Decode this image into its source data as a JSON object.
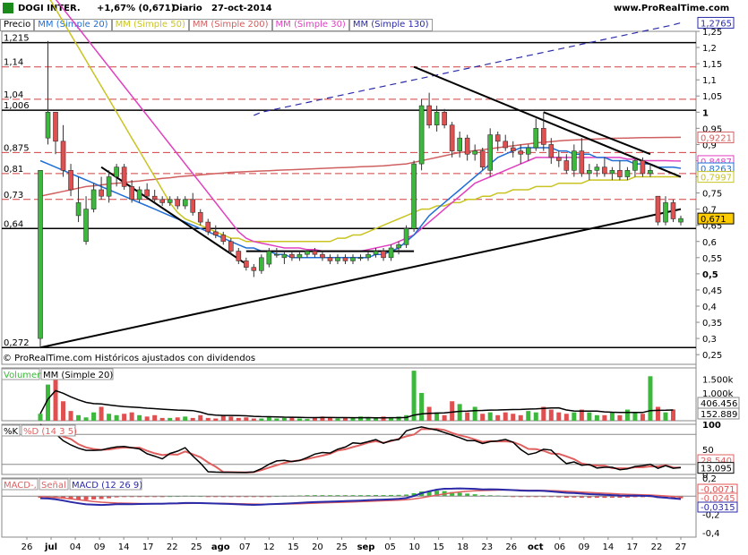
{
  "header": {
    "symbol": "DOGI INTER.",
    "change": "+1,67% (0,671)",
    "period": "Diario",
    "date": "27-oct-2014",
    "site": "www.ProRealTime.com"
  },
  "main_legend": [
    {
      "label": "Precio",
      "color": "#000000"
    },
    {
      "label": "MM (Simple 20)",
      "color": "#1f6fd6"
    },
    {
      "label": "MM (Simple 50)",
      "color": "#c9c422"
    },
    {
      "label": "MM (Simple 200)",
      "color": "#d06060"
    },
    {
      "label": "MM (Simple 30)",
      "color": "#e040c0"
    },
    {
      "label": "MM (Simple 130)",
      "color": "#2a2aa8"
    }
  ],
  "copyright": "© ProRealTime.com Históricos ajustados con dividendos",
  "chart_data": [
    {
      "type": "candlestick",
      "name": "price",
      "price_ticks": [
        "1,25",
        "1,2",
        "1,15",
        "1,1",
        "1,05",
        "1",
        "0,95",
        "0,9",
        "0,85",
        "0,8",
        "0,75",
        "0,7",
        "0,65",
        "0,6",
        "0,55",
        "0,5",
        "0,45",
        "0,4",
        "0,35",
        "0,3",
        "0,25"
      ],
      "ylim": [
        0.22,
        1.25
      ],
      "left_levels": [
        {
          "label": "1,215",
          "value": 1.215
        },
        {
          "label": "1,14",
          "value": 1.14
        },
        {
          "label": "1,04",
          "value": 1.04
        },
        {
          "label": "1,006",
          "value": 1.006
        },
        {
          "label": "0,875",
          "value": 0.875
        },
        {
          "label": "0,81",
          "value": 0.81
        },
        {
          "label": "0,73",
          "value": 0.73
        },
        {
          "label": "0,64",
          "value": 0.64
        },
        {
          "label": "0,272",
          "value": 0.272
        }
      ],
      "value_tags": [
        {
          "label": "1,2765",
          "value": 1.2765,
          "color": "#2a2aa8"
        },
        {
          "label": "0,9221",
          "value": 0.9221,
          "color": "#d06060"
        },
        {
          "label": "0,8487",
          "value": 0.8487,
          "color": "#e040c0"
        },
        {
          "label": "0,8263",
          "value": 0.8263,
          "color": "#1f6fd6"
        },
        {
          "label": "0,7997",
          "value": 0.7997,
          "color": "#c9c422"
        },
        {
          "label": "0,671",
          "value": 0.671,
          "color": "#000000"
        }
      ],
      "candles": [
        [
          0.3,
          0.82,
          0.27,
          0.82
        ],
        [
          0.92,
          1.22,
          0.9,
          1.0
        ],
        [
          1.0,
          1.0,
          0.87,
          0.91
        ],
        [
          0.91,
          0.96,
          0.8,
          0.82
        ],
        [
          0.82,
          0.84,
          0.74,
          0.76
        ],
        [
          0.68,
          0.8,
          0.66,
          0.72
        ],
        [
          0.6,
          0.74,
          0.59,
          0.7
        ],
        [
          0.7,
          0.78,
          0.69,
          0.76
        ],
        [
          0.76,
          0.8,
          0.73,
          0.74
        ],
        [
          0.74,
          0.82,
          0.72,
          0.8
        ],
        [
          0.8,
          0.84,
          0.77,
          0.83
        ],
        [
          0.83,
          0.84,
          0.76,
          0.77
        ],
        [
          0.77,
          0.79,
          0.72,
          0.73
        ],
        [
          0.73,
          0.77,
          0.72,
          0.76
        ],
        [
          0.76,
          0.78,
          0.73,
          0.74
        ],
        [
          0.74,
          0.76,
          0.72,
          0.73
        ],
        [
          0.73,
          0.74,
          0.71,
          0.72
        ],
        [
          0.72,
          0.74,
          0.71,
          0.73
        ],
        [
          0.73,
          0.74,
          0.7,
          0.71
        ],
        [
          0.71,
          0.74,
          0.7,
          0.73
        ],
        [
          0.73,
          0.75,
          0.68,
          0.69
        ],
        [
          0.69,
          0.7,
          0.65,
          0.66
        ],
        [
          0.66,
          0.67,
          0.62,
          0.63
        ],
        [
          0.63,
          0.65,
          0.61,
          0.62
        ],
        [
          0.62,
          0.63,
          0.59,
          0.6
        ],
        [
          0.6,
          0.61,
          0.56,
          0.57
        ],
        [
          0.57,
          0.58,
          0.53,
          0.54
        ],
        [
          0.54,
          0.55,
          0.51,
          0.52
        ],
        [
          0.52,
          0.53,
          0.49,
          0.51
        ],
        [
          0.51,
          0.56,
          0.5,
          0.55
        ],
        [
          0.53,
          0.58,
          0.52,
          0.57
        ],
        [
          0.56,
          0.58,
          0.55,
          0.56
        ],
        [
          0.55,
          0.57,
          0.53,
          0.56
        ],
        [
          0.56,
          0.57,
          0.54,
          0.55
        ],
        [
          0.55,
          0.57,
          0.54,
          0.56
        ],
        [
          0.56,
          0.57,
          0.55,
          0.57
        ],
        [
          0.57,
          0.58,
          0.55,
          0.56
        ],
        [
          0.56,
          0.57,
          0.54,
          0.55
        ],
        [
          0.55,
          0.56,
          0.53,
          0.54
        ],
        [
          0.54,
          0.56,
          0.53,
          0.55
        ],
        [
          0.55,
          0.56,
          0.53,
          0.54
        ],
        [
          0.54,
          0.56,
          0.53,
          0.55
        ],
        [
          0.55,
          0.56,
          0.54,
          0.55
        ],
        [
          0.55,
          0.57,
          0.54,
          0.56
        ],
        [
          0.56,
          0.58,
          0.55,
          0.57
        ],
        [
          0.57,
          0.58,
          0.54,
          0.55
        ],
        [
          0.55,
          0.59,
          0.54,
          0.58
        ],
        [
          0.58,
          0.6,
          0.56,
          0.59
        ],
        [
          0.59,
          0.65,
          0.58,
          0.64
        ],
        [
          0.64,
          0.85,
          0.63,
          0.84
        ],
        [
          0.84,
          1.04,
          0.82,
          1.02
        ],
        [
          1.02,
          1.06,
          0.95,
          0.96
        ],
        [
          0.96,
          1.02,
          0.94,
          1.0
        ],
        [
          1.0,
          1.01,
          0.95,
          0.96
        ],
        [
          0.96,
          0.97,
          0.86,
          0.88
        ],
        [
          0.88,
          0.94,
          0.86,
          0.92
        ],
        [
          0.92,
          0.93,
          0.85,
          0.87
        ],
        [
          0.87,
          0.9,
          0.85,
          0.88
        ],
        [
          0.88,
          0.89,
          0.82,
          0.83
        ],
        [
          0.82,
          0.95,
          0.8,
          0.93
        ],
        [
          0.93,
          0.94,
          0.88,
          0.91
        ],
        [
          0.91,
          0.93,
          0.88,
          0.89
        ],
        [
          0.89,
          0.91,
          0.86,
          0.88
        ],
        [
          0.88,
          0.9,
          0.84,
          0.87
        ],
        [
          0.87,
          0.9,
          0.85,
          0.89
        ],
        [
          0.89,
          0.98,
          0.88,
          0.95
        ],
        [
          0.95,
          1.0,
          0.88,
          0.9
        ],
        [
          0.9,
          0.92,
          0.84,
          0.86
        ],
        [
          0.86,
          0.88,
          0.83,
          0.85
        ],
        [
          0.85,
          0.87,
          0.81,
          0.82
        ],
        [
          0.82,
          0.9,
          0.8,
          0.88
        ],
        [
          0.88,
          0.92,
          0.8,
          0.81
        ],
        [
          0.81,
          0.84,
          0.79,
          0.82
        ],
        [
          0.82,
          0.84,
          0.8,
          0.83
        ],
        [
          0.83,
          0.86,
          0.8,
          0.81
        ],
        [
          0.81,
          0.83,
          0.79,
          0.82
        ],
        [
          0.82,
          0.85,
          0.79,
          0.8
        ],
        [
          0.8,
          0.83,
          0.79,
          0.82
        ],
        [
          0.82,
          0.86,
          0.8,
          0.85
        ],
        [
          0.85,
          0.86,
          0.8,
          0.81
        ],
        [
          0.81,
          0.84,
          0.8,
          0.82
        ],
        [
          0.74,
          0.74,
          0.65,
          0.66
        ],
        [
          0.66,
          0.74,
          0.65,
          0.72
        ],
        [
          0.72,
          0.73,
          0.66,
          0.67
        ],
        [
          0.66,
          0.68,
          0.65,
          0.671
        ]
      ],
      "ma20": [
        0.85,
        0.84,
        0.83,
        0.82,
        0.81,
        0.8,
        0.79,
        0.78,
        0.77,
        0.76,
        0.75,
        0.74,
        0.73,
        0.72,
        0.71,
        0.7,
        0.69,
        0.68,
        0.67,
        0.66,
        0.65,
        0.64,
        0.63,
        0.62,
        0.61,
        0.6,
        0.59,
        0.58,
        0.58,
        0.57,
        0.57,
        0.56,
        0.56,
        0.55,
        0.55,
        0.55,
        0.55,
        0.55,
        0.55,
        0.55,
        0.55,
        0.55,
        0.55,
        0.55,
        0.56,
        0.56,
        0.57,
        0.58,
        0.6,
        0.62,
        0.65,
        0.68,
        0.7,
        0.72,
        0.74,
        0.76,
        0.78,
        0.8,
        0.82,
        0.84,
        0.86,
        0.87,
        0.88,
        0.89,
        0.89,
        0.89,
        0.89,
        0.89,
        0.88,
        0.88,
        0.87,
        0.87,
        0.87,
        0.86,
        0.86,
        0.85,
        0.85,
        0.85,
        0.84,
        0.84,
        0.84,
        0.83,
        0.83,
        0.83,
        0.8263
      ],
      "ma50": [
        1.4,
        1.36,
        1.32,
        1.28,
        1.24,
        1.2,
        1.16,
        1.12,
        1.08,
        1.04,
        1.0,
        0.96,
        0.92,
        0.88,
        0.84,
        0.8,
        0.76,
        0.72,
        0.69,
        0.67,
        0.66,
        0.65,
        0.64,
        0.63,
        0.62,
        0.61,
        0.61,
        0.6,
        0.6,
        0.6,
        0.6,
        0.6,
        0.6,
        0.6,
        0.6,
        0.6,
        0.6,
        0.6,
        0.6,
        0.61,
        0.61,
        0.62,
        0.62,
        0.63,
        0.64,
        0.65,
        0.66,
        0.67,
        0.68,
        0.69,
        0.7,
        0.7,
        0.71,
        0.71,
        0.72,
        0.72,
        0.73,
        0.73,
        0.74,
        0.74,
        0.75,
        0.75,
        0.76,
        0.76,
        0.76,
        0.77,
        0.77,
        0.77,
        0.78,
        0.78,
        0.78,
        0.78,
        0.79,
        0.79,
        0.79,
        0.79,
        0.79,
        0.79,
        0.8,
        0.8,
        0.8,
        0.8,
        0.8,
        0.8,
        0.7997
      ],
      "ma200": [
        0.74,
        0.745,
        0.75,
        0.755,
        0.76,
        0.765,
        0.77,
        0.772,
        0.775,
        0.778,
        0.78,
        0.782,
        0.785,
        0.787,
        0.79,
        0.792,
        0.795,
        0.797,
        0.8,
        0.802,
        0.804,
        0.806,
        0.808,
        0.81,
        0.812,
        0.814,
        0.815,
        0.816,
        0.817,
        0.818,
        0.819,
        0.82,
        0.821,
        0.822,
        0.823,
        0.824,
        0.825,
        0.826,
        0.827,
        0.828,
        0.829,
        0.83,
        0.831,
        0.832,
        0.833,
        0.834,
        0.836,
        0.838,
        0.84,
        0.845,
        0.85,
        0.855,
        0.86,
        0.865,
        0.87,
        0.875,
        0.878,
        0.881,
        0.884,
        0.887,
        0.89,
        0.893,
        0.896,
        0.899,
        0.902,
        0.905,
        0.907,
        0.909,
        0.911,
        0.913,
        0.914,
        0.915,
        0.916,
        0.917,
        0.918,
        0.919,
        0.9195,
        0.92,
        0.9205,
        0.921,
        0.9212,
        0.9215,
        0.9218,
        0.922,
        0.9221
      ],
      "ma30": [
        1.4,
        1.38,
        1.35,
        1.32,
        1.29,
        1.26,
        1.23,
        1.2,
        1.17,
        1.14,
        1.11,
        1.08,
        1.05,
        1.02,
        0.99,
        0.96,
        0.93,
        0.9,
        0.87,
        0.84,
        0.81,
        0.78,
        0.75,
        0.72,
        0.69,
        0.66,
        0.63,
        0.61,
        0.6,
        0.595,
        0.59,
        0.585,
        0.58,
        0.58,
        0.58,
        0.575,
        0.575,
        0.57,
        0.57,
        0.57,
        0.57,
        0.57,
        0.57,
        0.575,
        0.58,
        0.585,
        0.59,
        0.6,
        0.61,
        0.62,
        0.64,
        0.66,
        0.68,
        0.7,
        0.72,
        0.74,
        0.76,
        0.78,
        0.79,
        0.8,
        0.81,
        0.82,
        0.83,
        0.84,
        0.85,
        0.86,
        0.86,
        0.86,
        0.86,
        0.86,
        0.86,
        0.86,
        0.86,
        0.86,
        0.86,
        0.86,
        0.86,
        0.855,
        0.855,
        0.85,
        0.85,
        0.85,
        0.85,
        0.849,
        0.8487
      ],
      "ma130": [
        0.99,
        1.0,
        1.005,
        1.01,
        1.015,
        1.02,
        1.025,
        1.03,
        1.035,
        1.04,
        1.045,
        1.05,
        1.055,
        1.06,
        1.065,
        1.07,
        1.075,
        1.08,
        1.085,
        1.09,
        1.095,
        1.1,
        1.105,
        1.11,
        1.115,
        1.12,
        1.125,
        1.13,
        1.135,
        1.14,
        1.145,
        1.15,
        1.155,
        1.16,
        1.165,
        1.17,
        1.175,
        1.18,
        1.185,
        1.19,
        1.195,
        1.2,
        1.205,
        1.21,
        1.215,
        1.22,
        1.225,
        1.23,
        1.235,
        1.24,
        1.245,
        1.25,
        1.255,
        1.26,
        1.265,
        1.27,
        1.2765
      ]
    },
    {
      "type": "bar",
      "name": "volume",
      "legend": [
        "Volumen",
        "MM (Simple 20)"
      ],
      "ticks": [
        "1.500k",
        "1.000k",
        "500k"
      ],
      "value_tags": [
        {
          "label": "406.456"
        },
        {
          "label": "152.889"
        }
      ],
      "values": [
        250,
        1300,
        1700,
        700,
        350,
        200,
        120,
        300,
        500,
        250,
        200,
        250,
        300,
        200,
        150,
        200,
        100,
        100,
        120,
        150,
        100,
        200,
        100,
        80,
        200,
        150,
        100,
        120,
        80,
        80,
        150,
        80,
        100,
        120,
        80,
        60,
        100,
        150,
        120,
        80,
        100,
        120,
        150,
        100,
        100,
        150,
        120,
        150,
        200,
        1800,
        1000,
        500,
        300,
        200,
        700,
        600,
        300,
        500,
        250,
        300,
        200,
        300,
        250,
        200,
        350,
        300,
        500,
        400,
        300,
        250,
        300,
        400,
        300,
        200,
        200,
        300,
        200,
        400,
        300,
        250,
        1600,
        500,
        300,
        406
      ]
    },
    {
      "type": "line",
      "name": "stochastic",
      "legend": [
        "%K",
        "%D (14 3 5)"
      ],
      "ticks": [
        "100",
        "50",
        "0"
      ],
      "value_tags": [
        {
          "label": "28,540"
        },
        {
          "label": "13,095"
        }
      ]
    },
    {
      "type": "line",
      "name": "macd",
      "legend": [
        "MACD-, señal",
        "Señal",
        "MACD (12 26 9)"
      ],
      "ticks": [
        "0,2",
        "0",
        "-0,2",
        "-0,4"
      ],
      "value_tags": [
        {
          "label": "-0,0071"
        },
        {
          "label": "-0,0245"
        },
        {
          "label": "-0,0315"
        }
      ]
    }
  ],
  "x_labels": [
    "26",
    "jul",
    "04",
    "09",
    "14",
    "17",
    "22",
    "25",
    "ago",
    "07",
    "12",
    "15",
    "20",
    "25",
    "sep",
    "05",
    "10",
    "15",
    "18",
    "23",
    "26",
    "oct",
    "06",
    "09",
    "14",
    "17",
    "22",
    "27"
  ],
  "x_bold": [
    "jul",
    "ago",
    "sep",
    "oct"
  ]
}
